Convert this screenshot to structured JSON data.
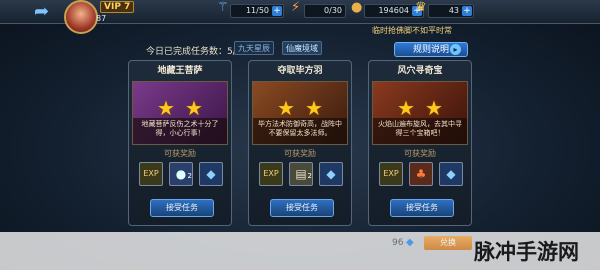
{
  "header": {
    "vip": "VIP 7",
    "level": "87",
    "stats": [
      {
        "icon": "stamina-icon",
        "value": "11/50"
      },
      {
        "icon": "energy-icon",
        "value": "0/30"
      },
      {
        "icon": "coin-icon",
        "value": "194604"
      },
      {
        "icon": "crown-icon",
        "value": "43"
      }
    ],
    "subtitle": "临时抢佛脚不如平时常",
    "timer": ""
  },
  "progress": {
    "text": "今日已完成任务数：5/10",
    "btn1": "九天星辰",
    "btn2": "仙魔境域"
  },
  "rules_label": "规则说明",
  "cards": [
    {
      "title": "地藏王菩萨",
      "desc": "地藏菩萨反伤之术十分了得，小心行事！",
      "reward_label": "可获奖励",
      "stars": 2,
      "items": [
        {
          "icon": "exp-icon",
          "label": "EXP",
          "count": ""
        },
        {
          "icon": "orb-icon",
          "label": "●",
          "count": "2"
        },
        {
          "icon": "crystal-icon",
          "label": "◆",
          "count": ""
        }
      ],
      "accept": "接受任务",
      "banner_color": "#5a2a6a"
    },
    {
      "title": "夺取毕方羽",
      "desc": "毕方法术防御奇高，战阵中不要保留太多法师。",
      "reward_label": "可获奖励",
      "stars": 2,
      "items": [
        {
          "icon": "exp-icon",
          "label": "EXP",
          "count": ""
        },
        {
          "icon": "scroll-icon",
          "label": "▤",
          "count": "2"
        },
        {
          "icon": "crystal-icon",
          "label": "◆",
          "count": ""
        }
      ],
      "accept": "接受任务",
      "banner_color": "#6a3a1a"
    },
    {
      "title": "风穴寻奇宝",
      "desc": "火焰山遍布旋风，去其中寻得三个宝箱吧！",
      "reward_label": "可获奖励",
      "stars": 2,
      "items": [
        {
          "icon": "exp-icon",
          "label": "EXP",
          "count": ""
        },
        {
          "icon": "mushroom-icon",
          "label": "♣",
          "count": ""
        },
        {
          "icon": "crystal-icon",
          "label": "◆",
          "count": ""
        }
      ],
      "accept": "接受任务",
      "banner_color": "#6a2a1a"
    }
  ],
  "bottom": {
    "gems": "96",
    "exchange": "兑换",
    "watermark": "脉冲手游网"
  },
  "colors": {
    "accent": "#2f7ad6",
    "star": "#ffc81e",
    "gold": "#f2d07a"
  }
}
